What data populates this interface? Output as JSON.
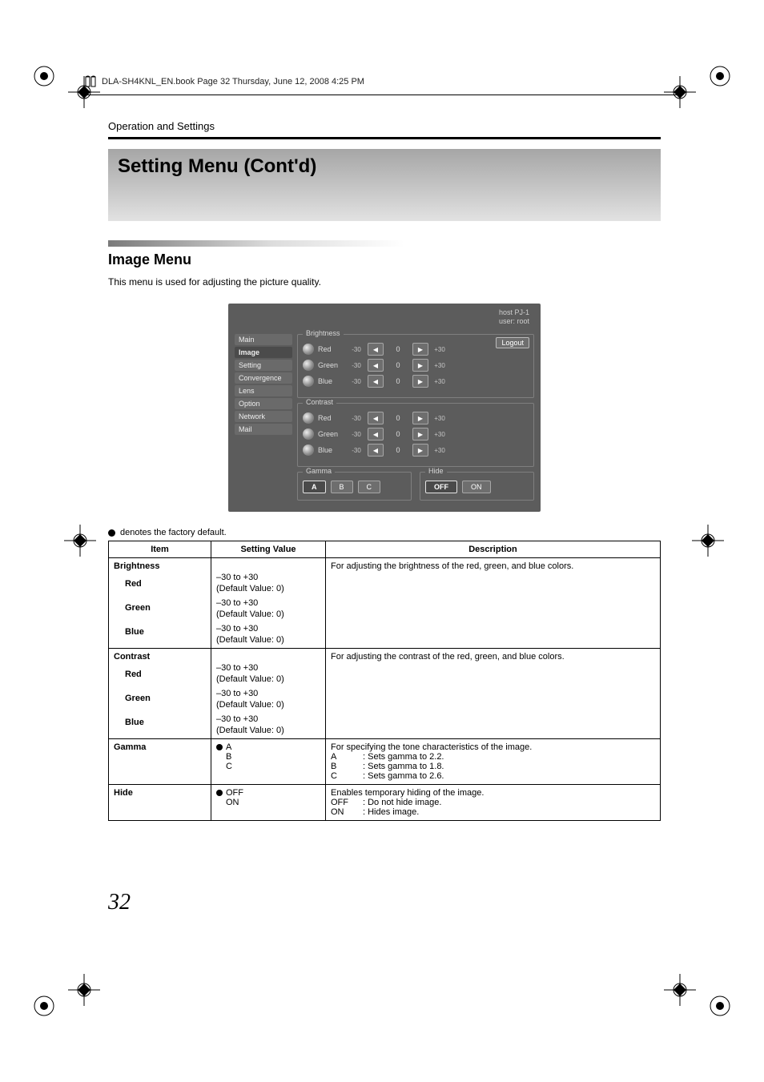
{
  "print_header": "DLA-SH4KNL_EN.book  Page 32  Thursday, June 12, 2008  4:25 PM",
  "section": "Operation and Settings",
  "title": "Setting Menu (Cont'd)",
  "subtitle": "Image Menu",
  "subtitle_desc": "This menu is used for adjusting the picture quality.",
  "page_number": "32",
  "device": {
    "host_line1": "host PJ-1",
    "host_line2": "user: root",
    "logout": "Logout",
    "sidebar": [
      "Main",
      "Image",
      "Setting",
      "Convergence",
      "Lens",
      "Option",
      "Network",
      "Mail"
    ],
    "active_sidebar_index": 1,
    "groups": {
      "brightness": {
        "label": "Brightness",
        "rows": [
          {
            "name": "Red",
            "min": "-30",
            "val": "0",
            "max": "+30"
          },
          {
            "name": "Green",
            "min": "-30",
            "val": "0",
            "max": "+30"
          },
          {
            "name": "Blue",
            "min": "-30",
            "val": "0",
            "max": "+30"
          }
        ]
      },
      "contrast": {
        "label": "Contrast",
        "rows": [
          {
            "name": "Red",
            "min": "-30",
            "val": "0",
            "max": "+30"
          },
          {
            "name": "Green",
            "min": "-30",
            "val": "0",
            "max": "+30"
          },
          {
            "name": "Blue",
            "min": "-30",
            "val": "0",
            "max": "+30"
          }
        ]
      },
      "gamma": {
        "label": "Gamma",
        "opts": [
          "A",
          "B",
          "C"
        ],
        "selected": 0
      },
      "hide": {
        "label": "Hide",
        "opts": [
          "OFF",
          "ON"
        ],
        "selected": 0
      }
    }
  },
  "factory_note": "denotes the factory default.",
  "table": {
    "headers": {
      "item": "Item",
      "value": "Setting Value",
      "desc": "Description"
    },
    "brightness": {
      "title": "Brightness",
      "desc": "For adjusting the brightness of the red, green, and blue colors.",
      "rows": [
        {
          "name": "Red",
          "v1": "–30 to +30",
          "v2": "(Default Value: 0)"
        },
        {
          "name": "Green",
          "v1": "–30 to +30",
          "v2": "(Default Value: 0)"
        },
        {
          "name": "Blue",
          "v1": "–30 to +30",
          "v2": "(Default Value: 0)"
        }
      ]
    },
    "contrast": {
      "title": "Contrast",
      "desc": "For adjusting the contrast of the red, green, and blue colors.",
      "rows": [
        {
          "name": "Red",
          "v1": "–30 to +30",
          "v2": "(Default Value: 0)"
        },
        {
          "name": "Green",
          "v1": "–30 to +30",
          "v2": "(Default Value: 0)"
        },
        {
          "name": "Blue",
          "v1": "–30 to +30",
          "v2": "(Default Value: 0)"
        }
      ]
    },
    "gamma": {
      "title": "Gamma",
      "opts": [
        "A",
        "B",
        "C"
      ],
      "default_index": 0,
      "desc_title": "For specifying the tone characteristics of the image.",
      "lines": [
        {
          "k": "A",
          "v": ": Sets gamma to 2.2."
        },
        {
          "k": "B",
          "v": ": Sets gamma to 1.8."
        },
        {
          "k": "C",
          "v": ": Sets gamma to 2.6."
        }
      ]
    },
    "hide": {
      "title": "Hide",
      "opts": [
        "OFF",
        "ON"
      ],
      "default_index": 0,
      "desc_title": "Enables temporary hiding of the image.",
      "lines": [
        {
          "k": "OFF",
          "v": ": Do not hide image."
        },
        {
          "k": "ON",
          "v": ": Hides image."
        }
      ]
    }
  }
}
